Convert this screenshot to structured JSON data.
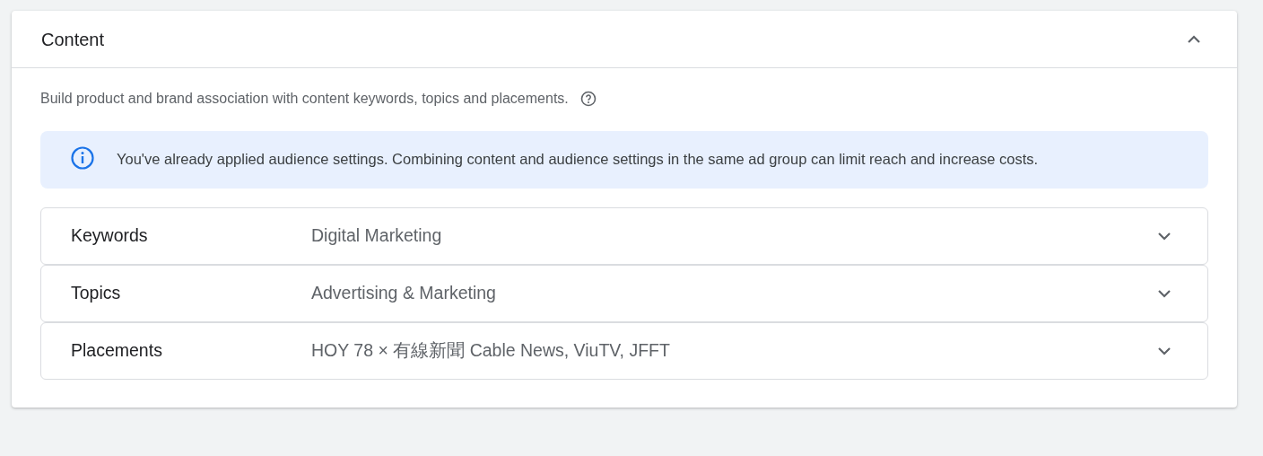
{
  "panel": {
    "title": "Content",
    "expanded": true,
    "description": "Build product and brand association with content keywords, topics and placements.",
    "notice": "You've already applied audience settings. Combining content and audience settings in the same ad group can limit reach and increase costs.",
    "sections": [
      {
        "label": "Keywords",
        "value": "Digital Marketing",
        "expanded": false
      },
      {
        "label": "Topics",
        "value": "Advertising & Marketing",
        "expanded": false
      },
      {
        "label": "Placements",
        "value": "HOY 78 × 有線新聞 Cable News, ViuTV, JFFT",
        "expanded": false
      }
    ]
  }
}
